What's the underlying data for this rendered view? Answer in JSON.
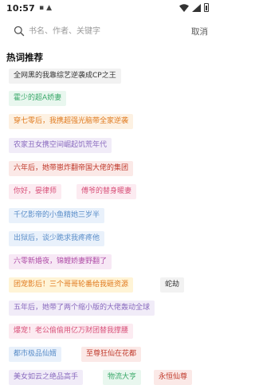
{
  "status_bar": {
    "time": "10:57",
    "icons": [
      "notification-icon",
      "upload-icon",
      "wifi-icon",
      "signal-icon",
      "battery-icon"
    ]
  },
  "search": {
    "placeholder": "书名、作者、关键字",
    "cancel_label": "取消"
  },
  "hot_words": {
    "title": "热词推荐",
    "tags": [
      {
        "label": "全网黑的我靠综艺逆袭成CP之王",
        "color": "#333333",
        "bg": "#f2f2f2"
      },
      {
        "label": "霍少的超A娇妻",
        "color": "#3aa96a",
        "bg": "#e9f7ef"
      },
      {
        "label": "穿七零后，我携超强光脑带全家逆袭",
        "color": "#e07a1f",
        "bg": "#fdf1e2"
      },
      {
        "label": "农家丑女携空间崛起饥荒年代",
        "color": "#8a6bbf",
        "bg": "#f1ecf8"
      },
      {
        "label": "六年后，她带崽炸翻帝国大佬的集团",
        "color": "#c0392b",
        "bg": "#fbe9e7"
      },
      {
        "label": "你好，晏律师",
        "color": "#d8527a",
        "bg": "#fcebf1"
      },
      {
        "label": "傅爷的替身暖妻",
        "color": "#d8527a",
        "bg": "#fcebf1"
      },
      {
        "label": "千亿影帝的小鱼精她三岁半",
        "color": "#5b8ec9",
        "bg": "#e9f1fb"
      },
      {
        "label": "出狱后，谈少跪求我疼疼他",
        "color": "#5b8ec9",
        "bg": "#e9f1fb"
      },
      {
        "label": "六零新婚夜，锦鲤娇妻野翻了",
        "color": "#b04fa8",
        "bg": "#f7e8f5"
      },
      {
        "label": "团宠影后！三个哥哥轮番给我砸资源",
        "color": "#e07a1f",
        "bg": "#fff4d6"
      },
      {
        "label": "蛇劫",
        "color": "#333333",
        "bg": "#f2f2f2"
      },
      {
        "label": "五年后，她带了两个缩小版的大佬轰动全球",
        "color": "#8a6bbf",
        "bg": "#f1ecf8"
      },
      {
        "label": "爆宠！老公偷偷用亿万财团替我撑腰",
        "color": "#d8527a",
        "bg": "#fcebf1"
      },
      {
        "label": "都市极品仙婿",
        "color": "#5b8ec9",
        "bg": "#e9f1fb"
      },
      {
        "label": "至尊狂仙在花都",
        "color": "#c0392b",
        "bg": "#fbe9e7"
      },
      {
        "label": "美女如云之绝品高手",
        "color": "#8a6bbf",
        "bg": "#f1ecf8"
      },
      {
        "label": "物流大亨",
        "color": "#3aa96a",
        "bg": "#e9f7ef"
      },
      {
        "label": "永恒仙尊",
        "color": "#c0392b",
        "bg": "#fbe9e7"
      }
    ]
  }
}
